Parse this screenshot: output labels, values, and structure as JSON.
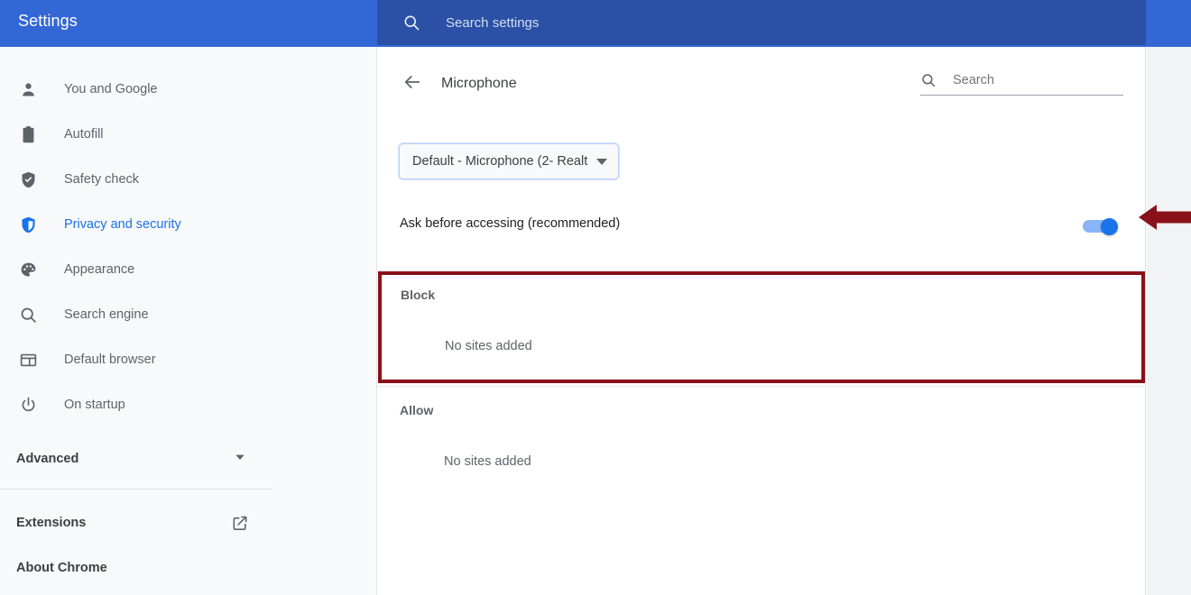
{
  "topbar": {
    "title": "Settings",
    "search_icon": "search-icon",
    "search_placeholder": "Search settings"
  },
  "sidebar": {
    "items": [
      {
        "label": "You and Google",
        "icon": "person-icon",
        "active": false
      },
      {
        "label": "Autofill",
        "icon": "clipboard-icon",
        "active": false
      },
      {
        "label": "Safety check",
        "icon": "shield-check-icon",
        "active": false
      },
      {
        "label": "Privacy and security",
        "icon": "shield-icon",
        "active": true
      },
      {
        "label": "Appearance",
        "icon": "palette-icon",
        "active": false
      },
      {
        "label": "Search engine",
        "icon": "search-icon",
        "active": false
      },
      {
        "label": "Default browser",
        "icon": "browser-window-icon",
        "active": false
      },
      {
        "label": "On startup",
        "icon": "power-icon",
        "active": false
      }
    ],
    "advanced": {
      "label": "Advanced",
      "icon": "chevron-down-icon"
    },
    "footer": [
      {
        "label": "Extensions",
        "icon": "external-link-icon"
      },
      {
        "label": "About Chrome",
        "icon": ""
      }
    ]
  },
  "content": {
    "back_icon": "back-arrow-icon",
    "title": "Microphone",
    "search": {
      "icon": "search-icon",
      "placeholder": "Search",
      "value": ""
    },
    "device_select": {
      "value": "Default - Microphone (2- Realt",
      "caret": "caret-down-icon"
    },
    "ask_setting": {
      "label": "Ask before accessing (recommended)",
      "toggle_state": "on"
    },
    "annotation": {
      "arrow_icon": "left-arrow-annotation",
      "arrow_color": "#8a1119",
      "highlight_color": "#8a1119"
    },
    "block_section": {
      "title": "Block",
      "empty_text": "No sites added"
    },
    "allow_section": {
      "title": "Allow",
      "empty_text": "No sites added"
    }
  },
  "colors": {
    "header_blue": "#3367d6",
    "search_blue": "#2a51a5",
    "accent_blue": "#1a73e8",
    "sidebar_bg": "#f8f9fa",
    "gutter_bg": "#f1f3f4",
    "annotation_red": "#8a1119"
  }
}
